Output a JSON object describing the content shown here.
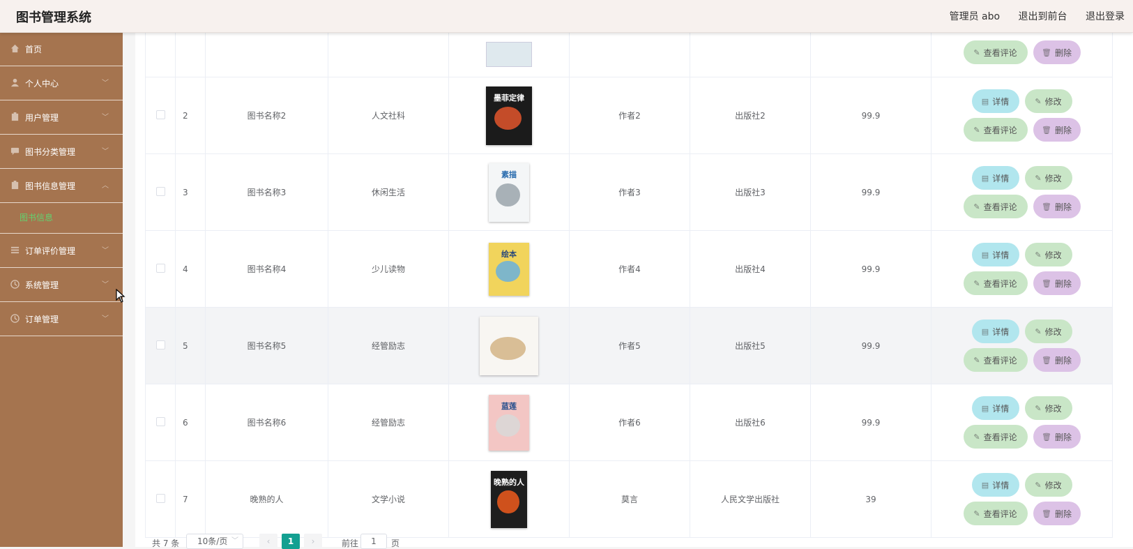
{
  "header": {
    "title": "图书管理系统",
    "user_label": "管理员 abo",
    "front_label": "退出到前台",
    "logout_label": "退出登录"
  },
  "sidebar": {
    "items": [
      {
        "label": "首页",
        "icon": "home-icon",
        "chevron": ""
      },
      {
        "label": "个人中心",
        "icon": "user-icon",
        "chevron": "﹀"
      },
      {
        "label": "用户管理",
        "icon": "clipboard-icon",
        "chevron": "﹀"
      },
      {
        "label": "图书分类管理",
        "icon": "chat-icon",
        "chevron": "﹀"
      },
      {
        "label": "图书信息管理",
        "icon": "clipboard-icon",
        "chevron": "︿"
      },
      {
        "label": "订单评价管理",
        "icon": "list-icon",
        "chevron": "﹀"
      },
      {
        "label": "系统管理",
        "icon": "clock-icon",
        "chevron": "﹀"
      },
      {
        "label": "订单管理",
        "icon": "clock-icon",
        "chevron": "﹀"
      }
    ],
    "active_subitem": "图书信息"
  },
  "table": {
    "actions": {
      "detail": "详情",
      "edit": "修改",
      "review": "查看评论",
      "delete": "删除"
    },
    "rows": [
      {
        "no": "2",
        "name": "图书名称2",
        "category": "人文社科",
        "author": "作者2",
        "publisher": "出版社2",
        "price": "99.9",
        "cover_title": "墨菲定律"
      },
      {
        "no": "3",
        "name": "图书名称3",
        "category": "休闲生活",
        "author": "作者3",
        "publisher": "出版社3",
        "price": "99.9",
        "cover_title": "素描"
      },
      {
        "no": "4",
        "name": "图书名称4",
        "category": "少儿读物",
        "author": "作者4",
        "publisher": "出版社4",
        "price": "99.9",
        "cover_title": "绘本"
      },
      {
        "no": "5",
        "name": "图书名称5",
        "category": "经管励志",
        "author": "作者5",
        "publisher": "出版社5",
        "price": "99.9",
        "cover_title": ""
      },
      {
        "no": "6",
        "name": "图书名称6",
        "category": "经管励志",
        "author": "作者6",
        "publisher": "出版社6",
        "price": "99.9",
        "cover_title": "蓝莲"
      },
      {
        "no": "7",
        "name": "晚熟的人",
        "category": "文学小说",
        "author": "莫言",
        "publisher": "人民文学出版社",
        "price": "39",
        "cover_title": "晚熟的人"
      }
    ]
  },
  "pagination": {
    "total": "共 7 条",
    "page_size": "10条/页",
    "current_page": "1",
    "goto_label": "前往",
    "goto_value": "1",
    "page_suffix": "页"
  },
  "colors": {
    "sidebar_bg": "#a5744f",
    "active_sub": "#62d26f",
    "page_active": "#13a091"
  }
}
